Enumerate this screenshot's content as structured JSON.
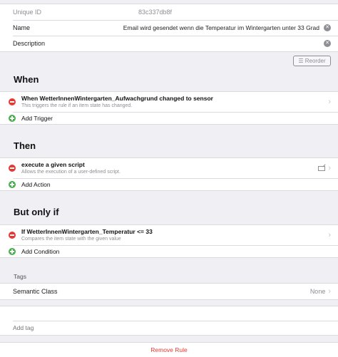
{
  "details": {
    "uid_label": "Unique ID",
    "uid_value": "83c337db8f",
    "name_label": "Name",
    "name_value": "Email wird gesendet wenn die Temperatur im Wintergarten unter 33 Grad",
    "description_label": "Description",
    "description_value": ""
  },
  "reorder_label": "Reorder",
  "when": {
    "title": "When",
    "items": [
      {
        "title": "When WetterInnenWintergarten_Aufwachgrund changed to sensor",
        "subtitle": "This triggers the rule if an item state has changed."
      }
    ],
    "add_label": "Add Trigger"
  },
  "then": {
    "title": "Then",
    "items": [
      {
        "title": "execute a given script",
        "subtitle": "Allows the execution of a user-defined script."
      }
    ],
    "add_label": "Add Action"
  },
  "but_only_if": {
    "title": "But only if",
    "items": [
      {
        "title": "If WetterInnenWintergarten_Temperatur <= 33",
        "subtitle": "Compares the item state with the given value"
      }
    ],
    "add_label": "Add Condition"
  },
  "tags": {
    "title": "Tags",
    "semantic_label": "Semantic Class",
    "semantic_value": "None",
    "add_tag_placeholder": "Add tag"
  },
  "remove_label": "Remove Rule",
  "colors": {
    "danger": "#e53935",
    "success": "#4caf50",
    "background": "#efeff4",
    "muted": "#8e8e93"
  }
}
